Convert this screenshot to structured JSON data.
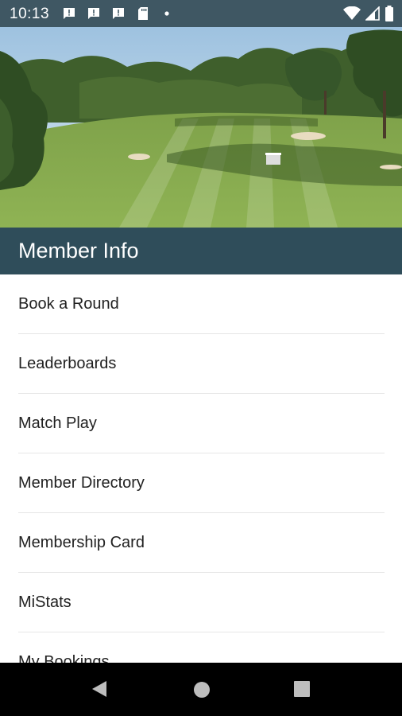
{
  "status_bar": {
    "time": "10:13",
    "notification_icons": [
      "message-alert-icon",
      "message-alert-icon",
      "message-alert-icon",
      "sd-card-icon"
    ],
    "right_icons": [
      "wifi-icon",
      "cell-signal-icon",
      "battery-icon"
    ]
  },
  "hero": {
    "image": "golf-course-fairway-photo"
  },
  "section": {
    "title": "Member Info"
  },
  "menu": {
    "items": [
      {
        "label": "Book a Round"
      },
      {
        "label": "Leaderboards"
      },
      {
        "label": "Match Play"
      },
      {
        "label": "Member Directory"
      },
      {
        "label": "Membership Card"
      },
      {
        "label": "MiStats"
      },
      {
        "label": "My Bookings"
      }
    ]
  },
  "nav_bar": {
    "buttons": [
      "back-icon",
      "home-icon",
      "recents-icon"
    ]
  },
  "colors": {
    "status_bar": "#3f5763",
    "header": "#2f4d5a",
    "divider": "#e6e6e6"
  }
}
